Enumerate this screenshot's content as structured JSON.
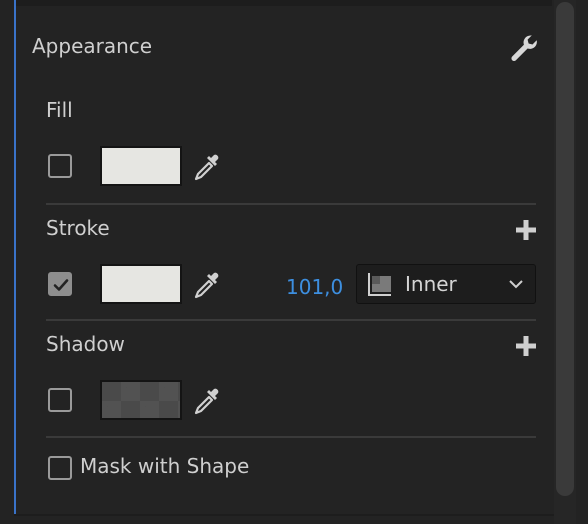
{
  "panel": {
    "title": "Appearance",
    "title_icon": "wrench-icon"
  },
  "fill": {
    "label": "Fill",
    "enabled": false,
    "color": "#e6e6e2"
  },
  "stroke": {
    "label": "Stroke",
    "enabled": true,
    "color": "#e6e6e2",
    "width_value": "101,0",
    "position": "Inner"
  },
  "shadow": {
    "label": "Shadow",
    "enabled": false,
    "color": "#4a4a4a"
  },
  "mask": {
    "label": "Mask with Shape",
    "enabled": false
  },
  "colors": {
    "accent": "#3d8fe0",
    "panel_bg": "#232323",
    "focus_border": "#3a73c9"
  }
}
